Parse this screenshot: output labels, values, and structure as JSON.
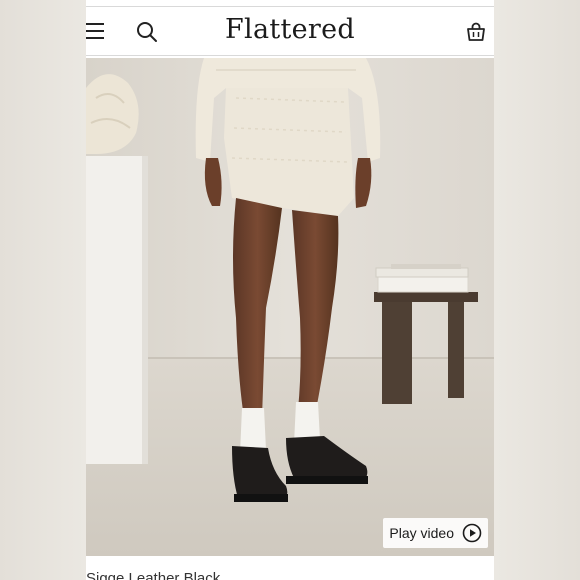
{
  "header": {
    "logo": "Flattered",
    "icons": {
      "menu": "hamburger-menu-icon",
      "search": "search-icon",
      "bag": "shopping-bag-icon"
    }
  },
  "media": {
    "play_label": "Play video",
    "play_icon": "play-circle-icon"
  },
  "product": {
    "title": "Sigge Leather Black"
  },
  "colors": {
    "page_background": "#e8e4dd",
    "header_background": "#ffffff",
    "text": "#1b1b1b"
  }
}
